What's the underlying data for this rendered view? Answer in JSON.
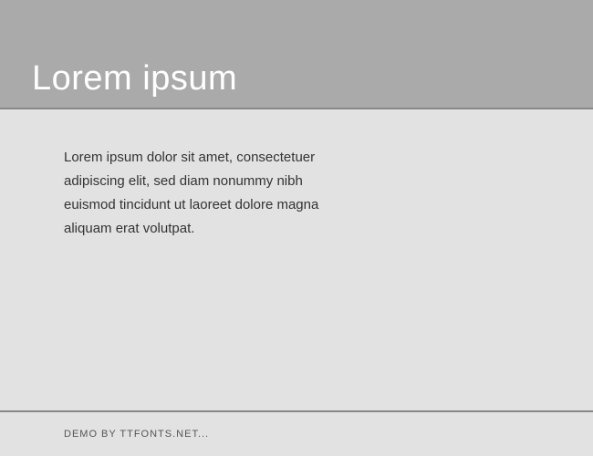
{
  "header": {
    "title": "Lorem ipsum"
  },
  "content": {
    "body": "Lorem ipsum dolor sit amet, consectetuer adipiscing elit, sed diam nonummy nibh euismod tincidunt ut laoreet dolore magna aliquam erat volutpat."
  },
  "footer": {
    "credit": "Demo by ttfonts.net..."
  }
}
